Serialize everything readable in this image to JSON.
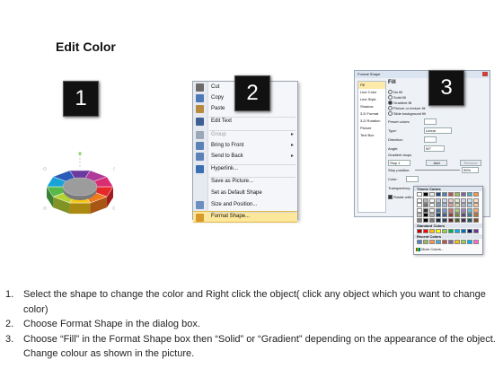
{
  "title": "Edit Color",
  "badges": [
    "1",
    "2",
    "3"
  ],
  "context_menu": {
    "items": [
      {
        "label": "Cut",
        "icon": "scissors-icon",
        "color": "#6b6b6b",
        "disabled": false,
        "arrow": false
      },
      {
        "label": "Copy",
        "icon": "copy-icon",
        "color": "#4f7ab8",
        "disabled": false,
        "arrow": false
      },
      {
        "label": "Paste",
        "icon": "paste-icon",
        "color": "#b78a3e",
        "disabled": false,
        "arrow": false
      },
      {
        "label": "Edit Text",
        "icon": "edit-text-icon",
        "color": "#3d5f93",
        "disabled": false,
        "arrow": false
      },
      {
        "label": "Group",
        "icon": "group-icon",
        "color": "#9aa8b8",
        "disabled": true,
        "arrow": true
      },
      {
        "label": "Bring to Front",
        "icon": "bring-to-front-icon",
        "color": "#5b82b6",
        "disabled": false,
        "arrow": true
      },
      {
        "label": "Send to Back",
        "icon": "send-to-back-icon",
        "color": "#5b82b6",
        "disabled": false,
        "arrow": true
      },
      {
        "label": "Hyperlink...",
        "icon": "hyperlink-icon",
        "color": "#3a6fb0",
        "disabled": false,
        "arrow": false
      },
      {
        "label": "Save as Picture...",
        "icon": "",
        "color": "",
        "disabled": false,
        "arrow": false
      },
      {
        "label": "Set as Default Shape",
        "icon": "",
        "color": "",
        "disabled": false,
        "arrow": false
      },
      {
        "label": "Size and Position...",
        "icon": "size-position-icon",
        "color": "#6d8fbf",
        "disabled": false,
        "arrow": false
      },
      {
        "label": "Format Shape...",
        "icon": "format-shape-icon",
        "color": "#d89a2a",
        "disabled": false,
        "arrow": false
      }
    ]
  },
  "dialog": {
    "title": "Format Shape",
    "nav": [
      "Fill",
      "Line Color",
      "Line Style",
      "Shadow",
      "3-D Format",
      "3-D Rotation",
      "Picture",
      "Text Box"
    ],
    "fill_heading": "Fill",
    "options": [
      "No fill",
      "Solid fill",
      "Gradient fill",
      "Picture or texture fill",
      "Slide background fill"
    ],
    "labels": {
      "preset": "Preset colors:",
      "type": "Type:",
      "type_value": "Linear",
      "direction": "Direction:",
      "angle": "Angle:",
      "angle_value": "90°",
      "stops": "Gradient stops",
      "stop": "Stop 1",
      "add": "Add",
      "remove": "Remove",
      "stop_position": "Stop position:",
      "stop_position_value": "99%",
      "color": "Color:",
      "transparency": "Transparency:",
      "rotate": "Rotate with shape"
    }
  },
  "palette": {
    "theme_label": "Theme Colors",
    "standard_label": "Standard Colors",
    "recent_label": "Recent Colors",
    "more_label": "More Colors...",
    "theme_top": [
      "#ffffff",
      "#000000",
      "#eeece1",
      "#1f497d",
      "#4f81bd",
      "#c0504d",
      "#9bbb59",
      "#8064a2",
      "#4bacc6",
      "#f79646"
    ],
    "standard": [
      "#c00000",
      "#ff0000",
      "#ffc000",
      "#ffff00",
      "#92d050",
      "#00b050",
      "#00b0f0",
      "#0070c0",
      "#002060",
      "#7030a0"
    ],
    "recent": [
      "#4f81bd",
      "#9bbb59",
      "#f79646",
      "#4bacc6",
      "#c0504d",
      "#8064a2",
      "#ffc000",
      "#92d050",
      "#00b0f0",
      "#ff66cc"
    ]
  },
  "ring_colors": [
    "#e8272a",
    "#f07b1d",
    "#f5c518",
    "#b5d334",
    "#55b848",
    "#18a3d8",
    "#2a5cb8",
    "#6a3aa0",
    "#b0399a",
    "#d82d74"
  ],
  "steps": [
    {
      "n": "1.",
      "text": "Select the shape to change the color and Right click the object( click any object which you want to change color)"
    },
    {
      "n": "2.",
      "text": "Choose Format Shape in the dialog box."
    },
    {
      "n": "3.",
      "text": "Choose “Fill” in the Format Shape box then “Solid” or “Gradient” depending on the appearance of the object. Change colour as shown in the picture."
    }
  ]
}
